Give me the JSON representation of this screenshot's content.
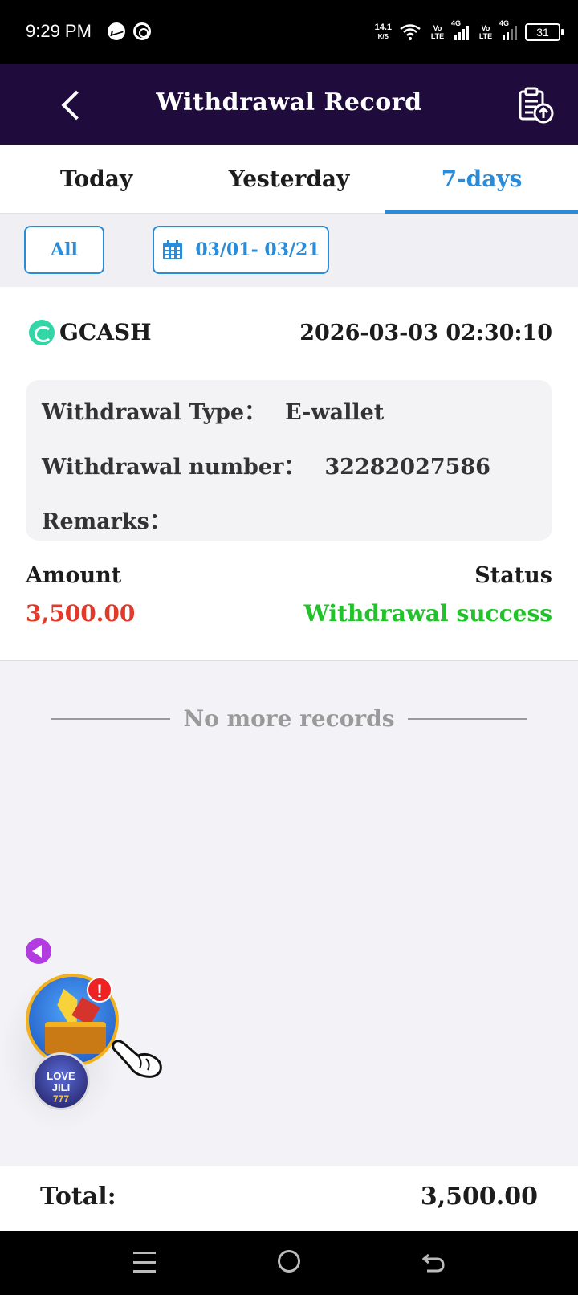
{
  "status_bar": {
    "time": "9:29 PM",
    "net_speed": "14.1",
    "net_speed_unit": "K/S",
    "volte_1": "Vo LTE",
    "net_1": "4G",
    "volte_2": "Vo LTE",
    "net_2": "4G",
    "battery": "31",
    "icons": [
      "messenger-icon",
      "fingerprint-icon",
      "wifi-icon",
      "signal-icon",
      "battery-icon"
    ]
  },
  "header": {
    "title": "Withdrawal Record",
    "back_icon": "chevron-left-icon",
    "action_icon": "clipboard-upload-icon",
    "background": "#1f0c3c"
  },
  "tabs": [
    {
      "label": "Today",
      "active": false
    },
    {
      "label": "Yesterday",
      "active": false
    },
    {
      "label": "7-days",
      "active": true
    }
  ],
  "filters": {
    "type_label": "All",
    "date_range": "03/01- 03/21",
    "accent": "#2a8bd8"
  },
  "record": {
    "provider": "GCASH",
    "datetime": "2026-03-03 02:30:10",
    "type_label": "Withdrawal Type：",
    "type_value": "E-wallet",
    "number_label": "Withdrawal number：",
    "number_value": "32282027586",
    "remarks_label": "Remarks：",
    "remarks_value": "",
    "amount_label": "Amount",
    "amount_value": "3,500.00",
    "status_label": "Status",
    "status_value": "Withdrawal success",
    "amount_color": "#e23a2a",
    "status_color": "#22c22a"
  },
  "list_end": "No more records",
  "floating_widget": {
    "alert": "!",
    "game_badge_line1": "LOVE",
    "game_badge_line2": "JILI",
    "game_badge_line3": "777"
  },
  "total": {
    "label": "Total:",
    "value": "3,500.00"
  },
  "nav_bar": {
    "icons": [
      "menu-icon",
      "home-icon",
      "back-icon"
    ]
  }
}
